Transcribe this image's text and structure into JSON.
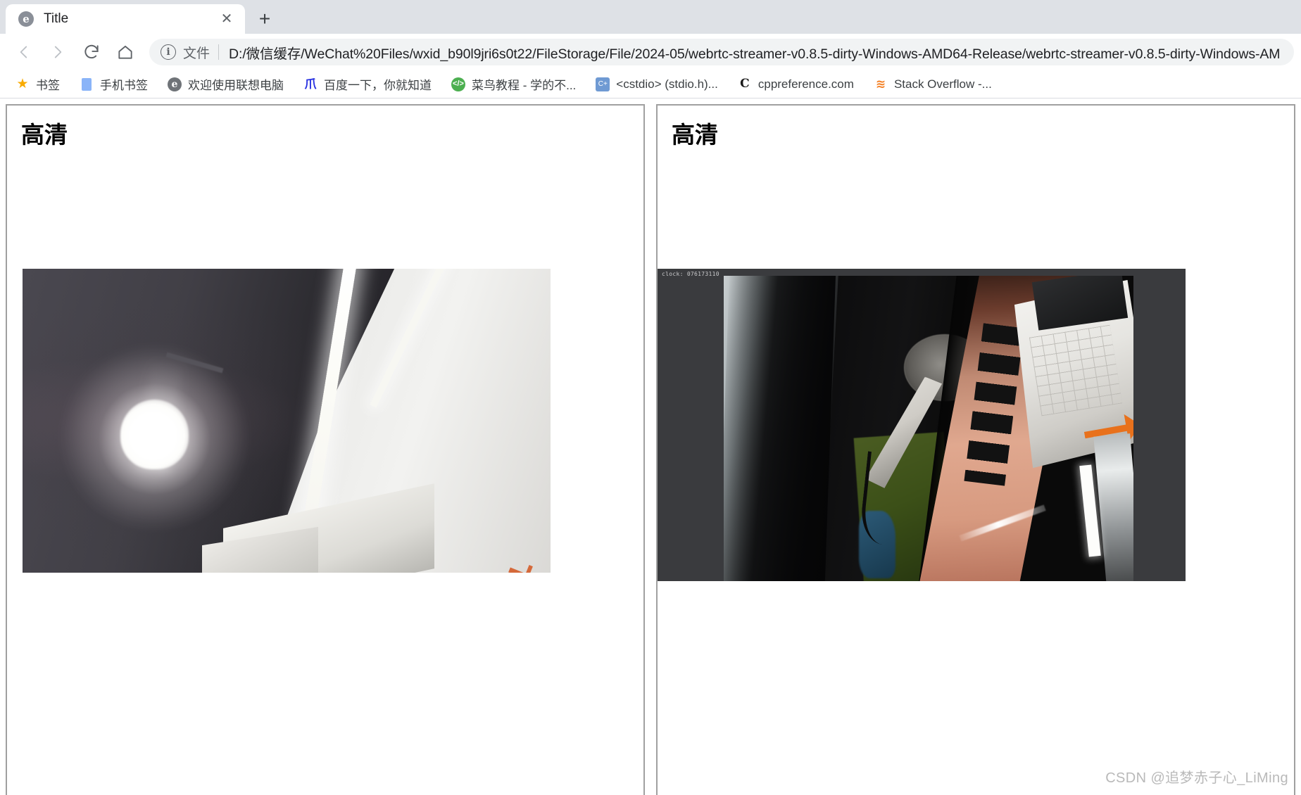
{
  "browser": {
    "tab": {
      "title": "Title",
      "favicon": "e",
      "close_label": "✕"
    },
    "newtab_label": "+",
    "nav": {
      "back": "back-arrow",
      "forward": "forward-arrow",
      "reload": "reload-arrow",
      "home": "home-house"
    },
    "omnibox": {
      "info_glyph": "i",
      "scheme_label": "文件",
      "url": "D:/微信缓存/WeChat%20Files/wxid_b90l9jri6s0t22/FileStorage/File/2024-05/webrtc-streamer-v0.8.5-dirty-Windows-AMD64-Release/webrtc-streamer-v0.8.5-dirty-Windows-AM"
    },
    "bookmarks": [
      {
        "label": "书签",
        "icon": "star-icon",
        "glyph": "★"
      },
      {
        "label": "手机书签",
        "icon": "phone-bookmark-icon",
        "glyph": ""
      },
      {
        "label": "欢迎使用联想电脑",
        "icon": "lenovo-icon",
        "glyph": "e"
      },
      {
        "label": "百度一下，你就知道",
        "icon": "baidu-icon",
        "glyph": "爪"
      },
      {
        "label": "菜鸟教程 - 学的不...",
        "icon": "runoob-icon",
        "glyph": "</>"
      },
      {
        "label": "<cstdio> (stdio.h)...",
        "icon": "cplusplus-icon",
        "glyph": "C+"
      },
      {
        "label": "cppreference.com",
        "icon": "cppreference-icon",
        "glyph": "C"
      },
      {
        "label": "Stack Overflow -...",
        "icon": "stackoverflow-icon",
        "glyph": "≋"
      }
    ]
  },
  "page": {
    "panels": [
      {
        "title": "高清",
        "video_name": "video-stream-left",
        "overlay_text": ""
      },
      {
        "title": "高清",
        "video_name": "video-stream-right",
        "overlay_text": "clock: 076173110"
      }
    ],
    "watermark": "CSDN @追梦赤子心_LiMing"
  },
  "colors": {
    "tabstrip_bg": "#dee1e6",
    "omnibox_bg": "#f1f3f4",
    "panel_border": "#a0a0a0",
    "accent_orange": "#f48024",
    "watermark": "#b9b9b9"
  }
}
